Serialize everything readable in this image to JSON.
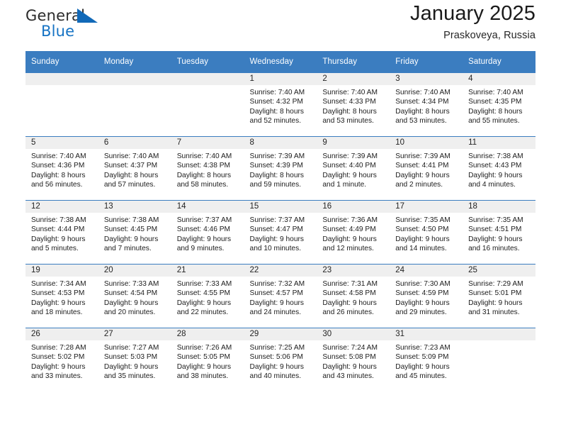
{
  "brand": {
    "name_top": "General",
    "name_bottom": "Blue",
    "accent_color": "#1169b8",
    "triangle_icon": "brand-triangle-icon"
  },
  "header": {
    "month_title": "January 2025",
    "location": "Praskoveya, Russia"
  },
  "calendar": {
    "header_color": "#3b7dc0",
    "weekdays": [
      "Sunday",
      "Monday",
      "Tuesday",
      "Wednesday",
      "Thursday",
      "Friday",
      "Saturday"
    ],
    "weeks": [
      [
        {
          "day": "",
          "sunrise": "",
          "sunset": "",
          "daylight_1": "",
          "daylight_2": ""
        },
        {
          "day": "",
          "sunrise": "",
          "sunset": "",
          "daylight_1": "",
          "daylight_2": ""
        },
        {
          "day": "",
          "sunrise": "",
          "sunset": "",
          "daylight_1": "",
          "daylight_2": ""
        },
        {
          "day": "1",
          "sunrise": "Sunrise: 7:40 AM",
          "sunset": "Sunset: 4:32 PM",
          "daylight_1": "Daylight: 8 hours",
          "daylight_2": "and 52 minutes."
        },
        {
          "day": "2",
          "sunrise": "Sunrise: 7:40 AM",
          "sunset": "Sunset: 4:33 PM",
          "daylight_1": "Daylight: 8 hours",
          "daylight_2": "and 53 minutes."
        },
        {
          "day": "3",
          "sunrise": "Sunrise: 7:40 AM",
          "sunset": "Sunset: 4:34 PM",
          "daylight_1": "Daylight: 8 hours",
          "daylight_2": "and 53 minutes."
        },
        {
          "day": "4",
          "sunrise": "Sunrise: 7:40 AM",
          "sunset": "Sunset: 4:35 PM",
          "daylight_1": "Daylight: 8 hours",
          "daylight_2": "and 55 minutes."
        }
      ],
      [
        {
          "day": "5",
          "sunrise": "Sunrise: 7:40 AM",
          "sunset": "Sunset: 4:36 PM",
          "daylight_1": "Daylight: 8 hours",
          "daylight_2": "and 56 minutes."
        },
        {
          "day": "6",
          "sunrise": "Sunrise: 7:40 AM",
          "sunset": "Sunset: 4:37 PM",
          "daylight_1": "Daylight: 8 hours",
          "daylight_2": "and 57 minutes."
        },
        {
          "day": "7",
          "sunrise": "Sunrise: 7:40 AM",
          "sunset": "Sunset: 4:38 PM",
          "daylight_1": "Daylight: 8 hours",
          "daylight_2": "and 58 minutes."
        },
        {
          "day": "8",
          "sunrise": "Sunrise: 7:39 AM",
          "sunset": "Sunset: 4:39 PM",
          "daylight_1": "Daylight: 8 hours",
          "daylight_2": "and 59 minutes."
        },
        {
          "day": "9",
          "sunrise": "Sunrise: 7:39 AM",
          "sunset": "Sunset: 4:40 PM",
          "daylight_1": "Daylight: 9 hours",
          "daylight_2": "and 1 minute."
        },
        {
          "day": "10",
          "sunrise": "Sunrise: 7:39 AM",
          "sunset": "Sunset: 4:41 PM",
          "daylight_1": "Daylight: 9 hours",
          "daylight_2": "and 2 minutes."
        },
        {
          "day": "11",
          "sunrise": "Sunrise: 7:38 AM",
          "sunset": "Sunset: 4:43 PM",
          "daylight_1": "Daylight: 9 hours",
          "daylight_2": "and 4 minutes."
        }
      ],
      [
        {
          "day": "12",
          "sunrise": "Sunrise: 7:38 AM",
          "sunset": "Sunset: 4:44 PM",
          "daylight_1": "Daylight: 9 hours",
          "daylight_2": "and 5 minutes."
        },
        {
          "day": "13",
          "sunrise": "Sunrise: 7:38 AM",
          "sunset": "Sunset: 4:45 PM",
          "daylight_1": "Daylight: 9 hours",
          "daylight_2": "and 7 minutes."
        },
        {
          "day": "14",
          "sunrise": "Sunrise: 7:37 AM",
          "sunset": "Sunset: 4:46 PM",
          "daylight_1": "Daylight: 9 hours",
          "daylight_2": "and 9 minutes."
        },
        {
          "day": "15",
          "sunrise": "Sunrise: 7:37 AM",
          "sunset": "Sunset: 4:47 PM",
          "daylight_1": "Daylight: 9 hours",
          "daylight_2": "and 10 minutes."
        },
        {
          "day": "16",
          "sunrise": "Sunrise: 7:36 AM",
          "sunset": "Sunset: 4:49 PM",
          "daylight_1": "Daylight: 9 hours",
          "daylight_2": "and 12 minutes."
        },
        {
          "day": "17",
          "sunrise": "Sunrise: 7:35 AM",
          "sunset": "Sunset: 4:50 PM",
          "daylight_1": "Daylight: 9 hours",
          "daylight_2": "and 14 minutes."
        },
        {
          "day": "18",
          "sunrise": "Sunrise: 7:35 AM",
          "sunset": "Sunset: 4:51 PM",
          "daylight_1": "Daylight: 9 hours",
          "daylight_2": "and 16 minutes."
        }
      ],
      [
        {
          "day": "19",
          "sunrise": "Sunrise: 7:34 AM",
          "sunset": "Sunset: 4:53 PM",
          "daylight_1": "Daylight: 9 hours",
          "daylight_2": "and 18 minutes."
        },
        {
          "day": "20",
          "sunrise": "Sunrise: 7:33 AM",
          "sunset": "Sunset: 4:54 PM",
          "daylight_1": "Daylight: 9 hours",
          "daylight_2": "and 20 minutes."
        },
        {
          "day": "21",
          "sunrise": "Sunrise: 7:33 AM",
          "sunset": "Sunset: 4:55 PM",
          "daylight_1": "Daylight: 9 hours",
          "daylight_2": "and 22 minutes."
        },
        {
          "day": "22",
          "sunrise": "Sunrise: 7:32 AM",
          "sunset": "Sunset: 4:57 PM",
          "daylight_1": "Daylight: 9 hours",
          "daylight_2": "and 24 minutes."
        },
        {
          "day": "23",
          "sunrise": "Sunrise: 7:31 AM",
          "sunset": "Sunset: 4:58 PM",
          "daylight_1": "Daylight: 9 hours",
          "daylight_2": "and 26 minutes."
        },
        {
          "day": "24",
          "sunrise": "Sunrise: 7:30 AM",
          "sunset": "Sunset: 4:59 PM",
          "daylight_1": "Daylight: 9 hours",
          "daylight_2": "and 29 minutes."
        },
        {
          "day": "25",
          "sunrise": "Sunrise: 7:29 AM",
          "sunset": "Sunset: 5:01 PM",
          "daylight_1": "Daylight: 9 hours",
          "daylight_2": "and 31 minutes."
        }
      ],
      [
        {
          "day": "26",
          "sunrise": "Sunrise: 7:28 AM",
          "sunset": "Sunset: 5:02 PM",
          "daylight_1": "Daylight: 9 hours",
          "daylight_2": "and 33 minutes."
        },
        {
          "day": "27",
          "sunrise": "Sunrise: 7:27 AM",
          "sunset": "Sunset: 5:03 PM",
          "daylight_1": "Daylight: 9 hours",
          "daylight_2": "and 35 minutes."
        },
        {
          "day": "28",
          "sunrise": "Sunrise: 7:26 AM",
          "sunset": "Sunset: 5:05 PM",
          "daylight_1": "Daylight: 9 hours",
          "daylight_2": "and 38 minutes."
        },
        {
          "day": "29",
          "sunrise": "Sunrise: 7:25 AM",
          "sunset": "Sunset: 5:06 PM",
          "daylight_1": "Daylight: 9 hours",
          "daylight_2": "and 40 minutes."
        },
        {
          "day": "30",
          "sunrise": "Sunrise: 7:24 AM",
          "sunset": "Sunset: 5:08 PM",
          "daylight_1": "Daylight: 9 hours",
          "daylight_2": "and 43 minutes."
        },
        {
          "day": "31",
          "sunrise": "Sunrise: 7:23 AM",
          "sunset": "Sunset: 5:09 PM",
          "daylight_1": "Daylight: 9 hours",
          "daylight_2": "and 45 minutes."
        },
        {
          "day": "",
          "sunrise": "",
          "sunset": "",
          "daylight_1": "",
          "daylight_2": ""
        }
      ]
    ]
  }
}
